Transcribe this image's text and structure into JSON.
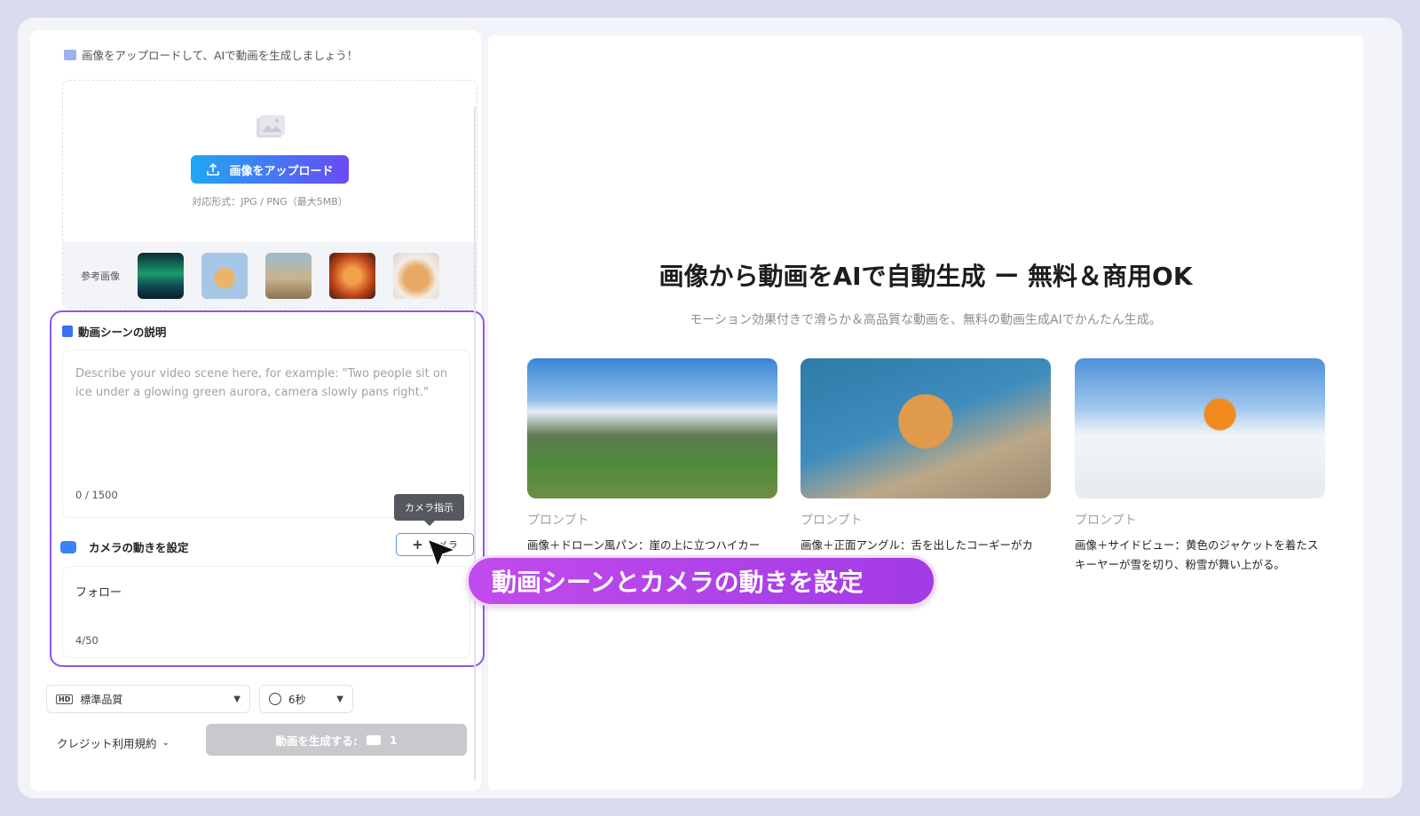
{
  "upload": {
    "heading": "画像をアップロードして、AIで動画を生成しましょう！",
    "button_label": "画像をアップロード",
    "hint": "対応形式：JPG / PNG（最大5MB）",
    "reference_label": "参考画像",
    "reference_thumbs": [
      "aurora",
      "bear",
      "cyclist",
      "perfume",
      "cat"
    ]
  },
  "scene": {
    "title": "動画シーンの説明",
    "placeholder": "Describe your video scene here, for example: \"Two people sit on ice under a glowing green aurora, camera slowly pans right.\"",
    "count": "0 / 1500"
  },
  "camera": {
    "title": "カメラの動きを設定",
    "tooltip": "カメラ指示",
    "button_label": "カメラ",
    "value": "フォロー",
    "count": "4/50"
  },
  "controls": {
    "quality": "標準品質",
    "duration": "6秒",
    "credit_terms": "クレジット利用規約",
    "generate_label": "動画を生成する:",
    "generate_cost": "1"
  },
  "hero": {
    "title": "画像から動画をAIで自動生成 ー 無料＆商用OK",
    "subtitle": "モーション効果付きで滑らか＆高品質な動画を、無料の動画生成AIでかんたん生成。"
  },
  "examples": [
    {
      "label": "プロンプト",
      "desc": "画像＋ドローン風パン：崖の上に立つハイカー"
    },
    {
      "label": "プロンプト",
      "desc": "画像＋正面アングル：舌を出したコーギーがカ　　　　　　　夕日の光が差し込む。"
    },
    {
      "label": "プロンプト",
      "desc": "画像＋サイドビュー：黄色のジャケットを着たスキーヤーが雪を切り、粉雪が舞い上がる。"
    }
  ],
  "banner": "動画シーンとカメラの動きを設定",
  "colors": {
    "accent_purple": "#8f55f0",
    "gradient_start": "#1fa7f5",
    "gradient_end": "#6a4bf3",
    "banner": "#b446e9"
  }
}
